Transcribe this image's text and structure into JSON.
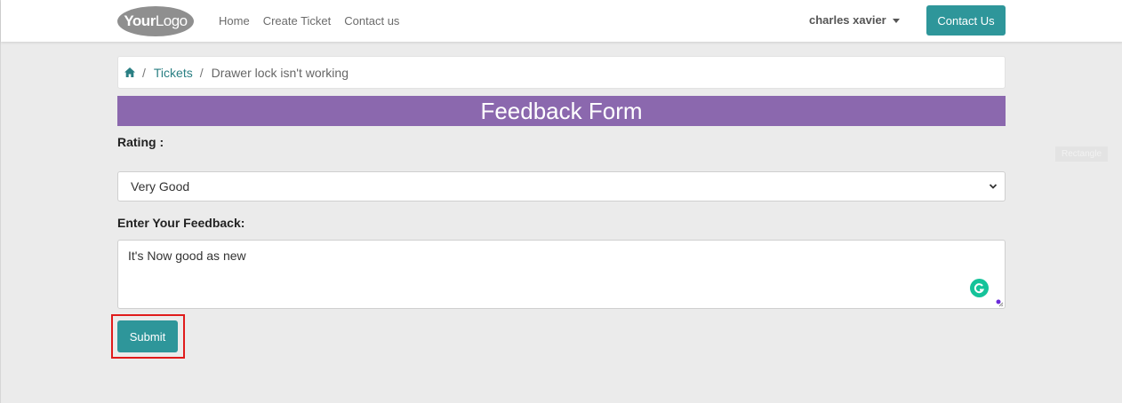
{
  "nav": {
    "logo_bold": "Your",
    "logo_rest": "Logo",
    "links": [
      "Home",
      "Create Ticket",
      "Contact us"
    ],
    "user_name": "charles xavier",
    "contact_button": "Contact Us"
  },
  "breadcrumb": {
    "home_icon": "home-icon",
    "separator": "/",
    "items": [
      "Tickets",
      "Drawer lock isn't working"
    ]
  },
  "form": {
    "title": "Feedback Form",
    "rating_label": "Rating :",
    "rating_value": "Very Good",
    "feedback_label": "Enter Your Feedback:",
    "feedback_value": "It's Now good as new",
    "submit_label": "Submit"
  },
  "overlay": {
    "ghost_label": "Rectangle"
  },
  "colors": {
    "accent": "#2e969a",
    "header_purple": "#8b68ae",
    "link": "#2a7f83",
    "highlight": "#e01b1b",
    "grammarly": "#15c39a"
  }
}
